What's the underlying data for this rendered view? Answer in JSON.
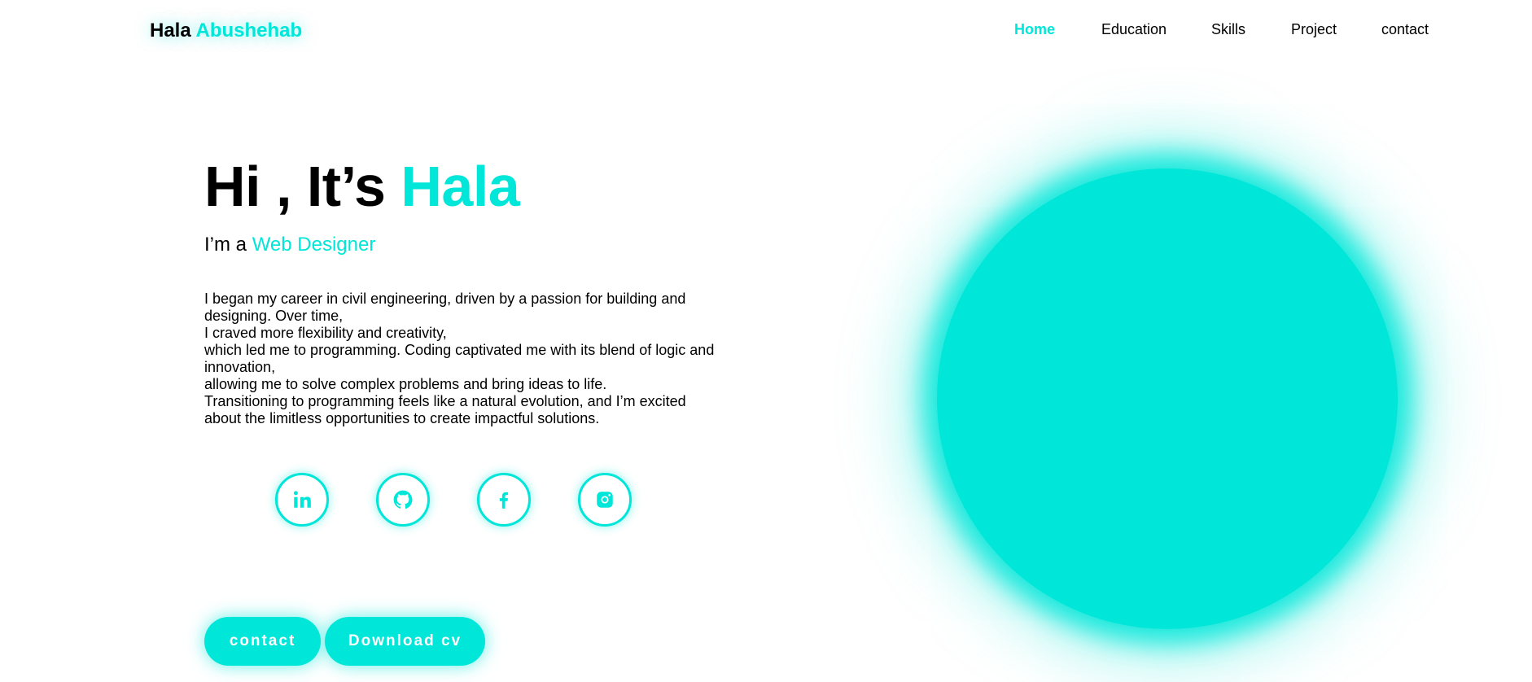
{
  "brand": {
    "first": "Hala",
    "last": "Abushehab"
  },
  "nav": {
    "items": [
      {
        "label": "Home",
        "active": true
      },
      {
        "label": "Education"
      },
      {
        "label": "Skills"
      },
      {
        "label": "Project"
      },
      {
        "label": "contact"
      }
    ]
  },
  "hero": {
    "greeting": "Hi , It’s ",
    "name": "Hala",
    "role_prefix": "I’m a ",
    "role": "Web Designer",
    "bio_lines": [
      "I began my career in civil engineering, driven by a passion for building and",
      "designing. Over time,",
      "I craved more flexibility and creativity,",
      "which led me to programming. Coding captivated me with its blend of logic and",
      "innovation,",
      "allowing me to solve complex problems and bring ideas to life.",
      "Transitioning to programming feels like a natural evolution, and I’m excited",
      "about the limitless opportunities to create impactful solutions."
    ]
  },
  "socials": [
    {
      "icon": "linkedin-icon"
    },
    {
      "icon": "github-icon"
    },
    {
      "icon": "facebook-icon"
    },
    {
      "icon": "instagram-icon"
    }
  ],
  "buttons": {
    "contact": "contact",
    "download": "Download cv"
  },
  "colors": {
    "accent": "#00E6D8",
    "text": "#000000",
    "background": "#FFFFFF"
  }
}
